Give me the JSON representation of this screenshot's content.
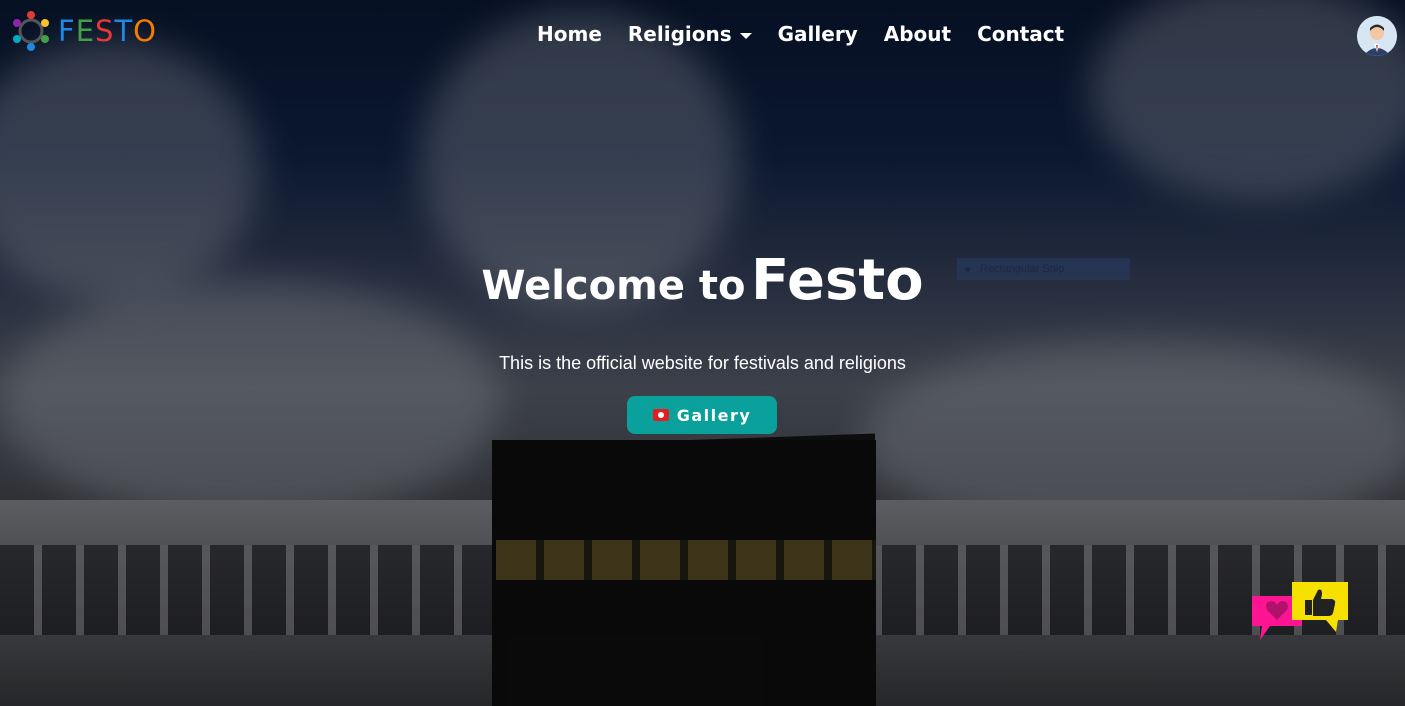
{
  "brand": {
    "letters": [
      "F",
      "E",
      "S",
      "T",
      "O"
    ],
    "letter_colors": [
      "#1e88e5",
      "#43a047",
      "#e53935",
      "#1e88e5",
      "#f57c00"
    ]
  },
  "nav": {
    "items": [
      {
        "label": "Home"
      },
      {
        "label": "Religions",
        "has_dropdown": true
      },
      {
        "label": "Gallery"
      },
      {
        "label": "About"
      },
      {
        "label": "Contact"
      }
    ]
  },
  "hero": {
    "title_prefix": "Welcome to",
    "title_brand": "Festo",
    "subtitle": "This is the official website for festivals and religions",
    "button_label": "Gallery",
    "button_icon": "camera-icon",
    "button_color": "#0aa09c"
  },
  "stray_label": "Rectangular Snip",
  "widget": {
    "icons": [
      "heart-chat-icon",
      "thumbs-up-chat-icon"
    ],
    "colors": [
      "#ff1493",
      "#f5e000"
    ]
  },
  "user": {
    "avatar_icon": "user-avatar-icon"
  }
}
